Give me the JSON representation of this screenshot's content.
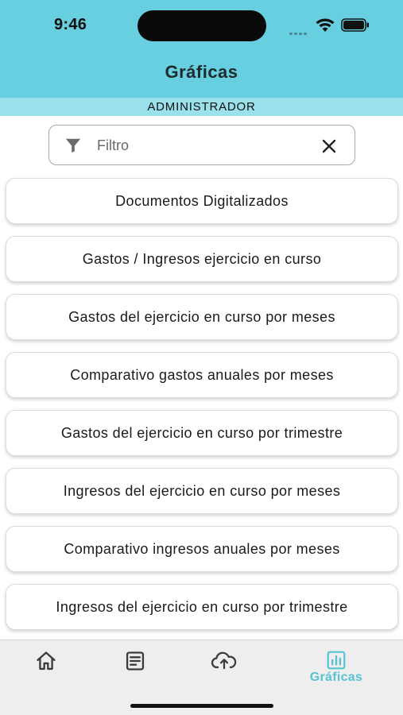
{
  "status_bar": {
    "time": "9:46"
  },
  "header": {
    "title": "Gráficas",
    "role": "ADMINISTRADOR"
  },
  "filter": {
    "placeholder": "Filtro",
    "value": ""
  },
  "items": [
    {
      "label": "Documentos Digitalizados"
    },
    {
      "label": "Gastos / Ingresos ejercicio en curso"
    },
    {
      "label": "Gastos del ejercicio en curso por meses"
    },
    {
      "label": "Comparativo gastos anuales por meses"
    },
    {
      "label": "Gastos del ejercicio en curso por trimestre"
    },
    {
      "label": "Ingresos del ejercicio en curso por meses"
    },
    {
      "label": "Comparativo ingresos anuales por meses"
    },
    {
      "label": "Ingresos del ejercicio en curso por trimestre"
    }
  ],
  "tabbar": {
    "tabs": [
      {
        "icon": "home-icon",
        "label": ""
      },
      {
        "icon": "document-icon",
        "label": ""
      },
      {
        "icon": "cloud-upload-icon",
        "label": ""
      },
      {
        "icon": "chart-icon",
        "label": "Gráficas",
        "active": true
      }
    ]
  },
  "colors": {
    "header": "#67cfdf",
    "role_bar": "#9be1eb",
    "active_tab": "#56c3d3"
  }
}
